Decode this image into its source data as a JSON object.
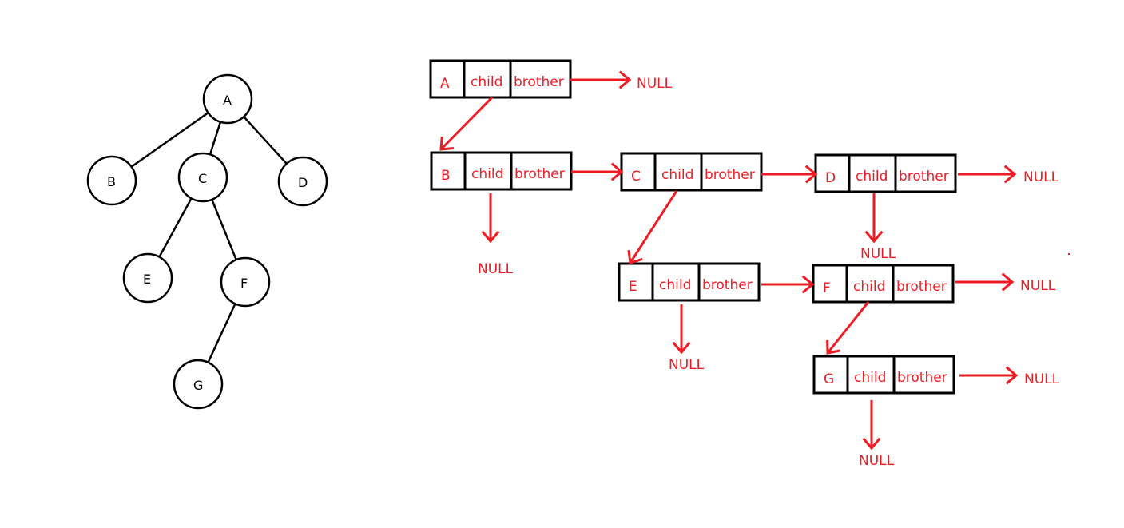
{
  "colors": {
    "tree": "#000000",
    "record_border": "#000000",
    "pointer": "#ed1c24",
    "record_text": "#ed1c24"
  },
  "tree": {
    "nodes": [
      "A",
      "B",
      "C",
      "D",
      "E",
      "F",
      "G"
    ],
    "edges": [
      [
        "A",
        "B"
      ],
      [
        "A",
        "C"
      ],
      [
        "A",
        "D"
      ],
      [
        "C",
        "E"
      ],
      [
        "C",
        "F"
      ],
      [
        "F",
        "G"
      ]
    ]
  },
  "records": [
    {
      "label": "A",
      "child_field": "child",
      "brother_field": "brother",
      "child": "B",
      "brother": "NULL"
    },
    {
      "label": "B",
      "child_field": "child",
      "brother_field": "brother",
      "child": "NULL",
      "brother": "C"
    },
    {
      "label": "C",
      "child_field": "child",
      "brother_field": "brother",
      "child": "E",
      "brother": "D"
    },
    {
      "label": "D",
      "child_field": "child",
      "brother_field": "brother",
      "child": "NULL",
      "brother": "NULL"
    },
    {
      "label": "E",
      "child_field": "child",
      "brother_field": "brother",
      "child": "NULL",
      "brother": "F"
    },
    {
      "label": "F",
      "child_field": "child",
      "brother_field": "brother",
      "child": "G",
      "brother": "NULL"
    },
    {
      "label": "G",
      "child_field": "child",
      "brother_field": "brother",
      "child": "NULL",
      "brother": "NULL"
    }
  ],
  "null_label": "NULL"
}
